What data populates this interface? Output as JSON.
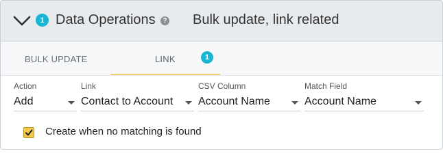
{
  "header": {
    "count_badge": "1",
    "title": "Data Operations",
    "help_glyph": "?",
    "subtitle": "Bulk update, link related",
    "icons": {
      "collapse": "chevron-down-icon",
      "help": "help-icon"
    },
    "colors": {
      "badge": "#18b5d4",
      "background": "#e8ebee"
    }
  },
  "tabs": [
    {
      "label": "BULK UPDATE",
      "active": false
    },
    {
      "label": "LINK",
      "active": true,
      "badge": "1"
    }
  ],
  "form": {
    "action": {
      "label": "Action",
      "value": "Add"
    },
    "link": {
      "label": "Link",
      "value": "Contact to Account"
    },
    "csv_column": {
      "label": "CSV Column",
      "value": "Account Name"
    },
    "match_field": {
      "label": "Match Field",
      "value": "Account Name"
    }
  },
  "create_when_no_match": {
    "label": "Create when no matching is found",
    "checked": true,
    "color": "#f2c94c"
  }
}
